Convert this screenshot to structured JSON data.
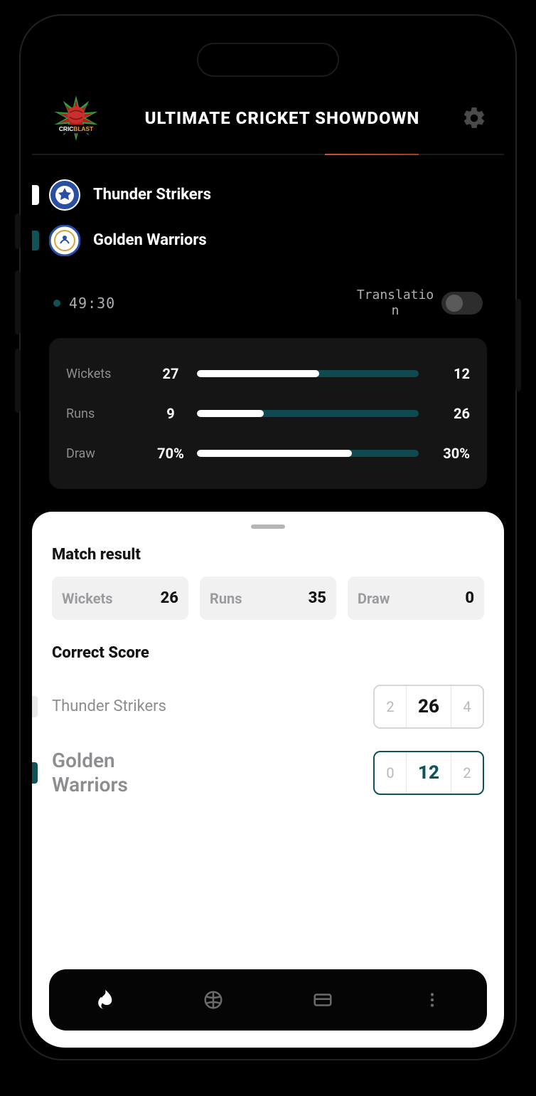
{
  "header": {
    "title": "ULTIMATE CRICKET SHOWDOWN",
    "logo_text_top": "CRIC",
    "logo_text_accent": "BLAST"
  },
  "teams": {
    "home": {
      "name": "Thunder Strikers",
      "tab_color": "#ffffff",
      "badge_bg": "#2a4ea0",
      "badge_ring": "#ffffff"
    },
    "away": {
      "name": "Golden Warriors",
      "tab_color": "#0f5257",
      "badge_bg": "#ffffff",
      "badge_ring": "#2850a8"
    }
  },
  "timer": {
    "value": "49:30"
  },
  "toggle": {
    "label": "Translation",
    "on": false
  },
  "stats": [
    {
      "label": "Wickets",
      "left": "27",
      "right": "12",
      "left_pct": 55
    },
    {
      "label": "Runs",
      "left": "9",
      "right": "26",
      "left_pct": 30
    },
    {
      "label": "Draw",
      "left": "70%",
      "right": "30%",
      "left_pct": 70
    }
  ],
  "sheet": {
    "match_result_title": "Match result",
    "chips": [
      {
        "label": "Wickets",
        "value": "26"
      },
      {
        "label": "Runs",
        "value": "35"
      },
      {
        "label": "Draw",
        "value": "0"
      }
    ],
    "correct_score_title": "Correct Score",
    "scores": [
      {
        "name": "Thunder Strikers",
        "tab_color": "#e9e9e9",
        "prev": "2",
        "mid": "26",
        "next": "4",
        "active": false
      },
      {
        "name": "Golden Warriors",
        "tab_color": "#0f5257",
        "prev": "0",
        "mid": "12",
        "next": "2",
        "active": true
      }
    ]
  },
  "colors": {
    "accent": "#0f5257",
    "divider_active": "#c9552c"
  }
}
